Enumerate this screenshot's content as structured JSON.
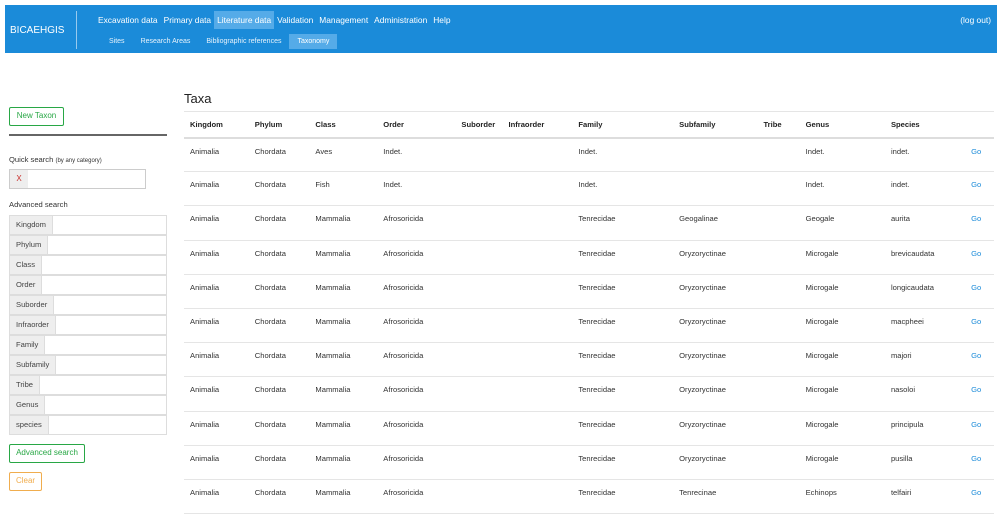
{
  "brand": "BICAEHGIS",
  "nav": [
    "Excavation data",
    "Primary data",
    "Literature data",
    "Validation",
    "Management",
    "Administration",
    "Help"
  ],
  "nav_active": 2,
  "subnav": [
    "Sites",
    "Research Areas",
    "Bibliographic references",
    "Taxonomy"
  ],
  "subnav_active": 3,
  "logout": "(log out)",
  "sidebar": {
    "new_taxon": "New Taxon",
    "quick_search_label": "Quick search",
    "quick_search_hint": "(by any category)",
    "clear_x": "X",
    "advanced_label": "Advanced search",
    "fields": [
      "Kingdom",
      "Phylum",
      "Class",
      "Order",
      "Suborder",
      "Infraorder",
      "Family",
      "Subfamily",
      "Tribe",
      "Genus",
      "species"
    ],
    "advanced_button": "Advanced search",
    "clear_button": "Clear"
  },
  "title": "Taxa",
  "columns": [
    "Kingdom",
    "Phylum",
    "Class",
    "Order",
    "Suborder",
    "Infraorder",
    "Family",
    "Subfamily",
    "Tribe",
    "Genus",
    "Species",
    ""
  ],
  "link_label": "Go",
  "rows": [
    [
      "Animalia",
      "Chordata",
      "Aves",
      "Indet.",
      "",
      "",
      "Indet.",
      "",
      "",
      "Indet.",
      "indet."
    ],
    [
      "Animalia",
      "Chordata",
      "Fish",
      "Indet.",
      "",
      "",
      "Indet.",
      "",
      "",
      "Indet.",
      "indet."
    ],
    [
      "Animalia",
      "Chordata",
      "Mammalia",
      "Afrosoricida",
      "",
      "",
      "Tenrecidae",
      "Geogalinae",
      "",
      "Geogale",
      "aurita"
    ],
    [
      "Animalia",
      "Chordata",
      "Mammalia",
      "Afrosoricida",
      "",
      "",
      "Tenrecidae",
      "Oryzoryctinae",
      "",
      "Microgale",
      "brevicaudata"
    ],
    [
      "Animalia",
      "Chordata",
      "Mammalia",
      "Afrosoricida",
      "",
      "",
      "Tenrecidae",
      "Oryzoryctinae",
      "",
      "Microgale",
      "longicaudata"
    ],
    [
      "Animalia",
      "Chordata",
      "Mammalia",
      "Afrosoricida",
      "",
      "",
      "Tenrecidae",
      "Oryzoryctinae",
      "",
      "Microgale",
      "macpheei"
    ],
    [
      "Animalia",
      "Chordata",
      "Mammalia",
      "Afrosoricida",
      "",
      "",
      "Tenrecidae",
      "Oryzoryctinae",
      "",
      "Microgale",
      "majori"
    ],
    [
      "Animalia",
      "Chordata",
      "Mammalia",
      "Afrosoricida",
      "",
      "",
      "Tenrecidae",
      "Oryzoryctinae",
      "",
      "Microgale",
      "nasoloi"
    ],
    [
      "Animalia",
      "Chordata",
      "Mammalia",
      "Afrosoricida",
      "",
      "",
      "Tenrecidae",
      "Oryzoryctinae",
      "",
      "Microgale",
      "principula"
    ],
    [
      "Animalia",
      "Chordata",
      "Mammalia",
      "Afrosoricida",
      "",
      "",
      "Tenrecidae",
      "Oryzoryctinae",
      "",
      "Microgale",
      "pusilla"
    ],
    [
      "Animalia",
      "Chordata",
      "Mammalia",
      "Afrosoricida",
      "",
      "",
      "Tenrecidae",
      "Tenrecinae",
      "",
      "Echinops",
      "telfairi"
    ]
  ]
}
